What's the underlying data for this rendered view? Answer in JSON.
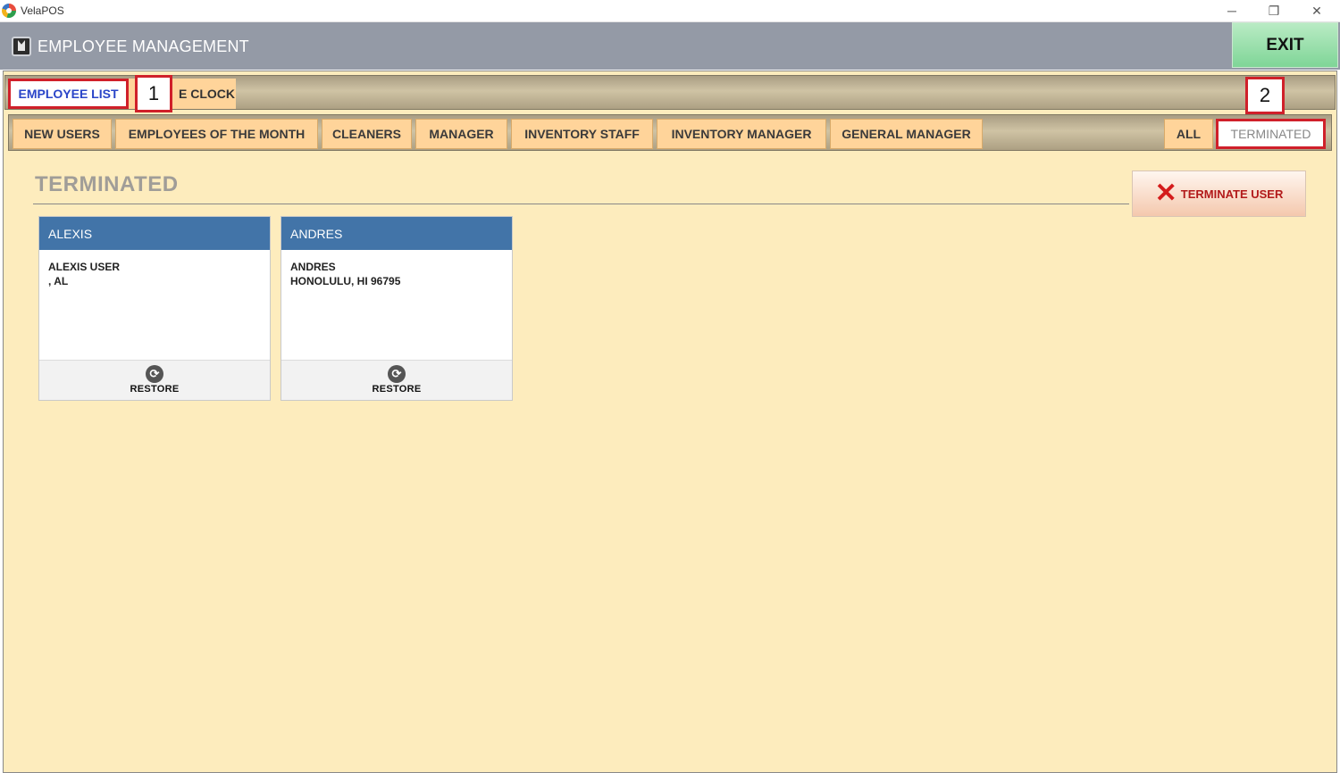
{
  "window": {
    "title": "VelaPOS",
    "controls": {
      "minimize": "─",
      "maximize": "❐",
      "close": "✕"
    }
  },
  "header": {
    "title": "EMPLOYEE MANAGEMENT",
    "exit_label": "EXIT"
  },
  "main_tabs": {
    "employee_list": "EMPLOYEE LIST",
    "time_clock": "E CLOCK"
  },
  "filters": [
    "NEW USERS",
    "EMPLOYEES OF THE MONTH",
    "CLEANERS",
    "MANAGER",
    "INVENTORY STAFF",
    "INVENTORY MANAGER",
    "GENERAL MANAGER",
    "ALL",
    "TERMINATED"
  ],
  "callouts": [
    "1",
    "2"
  ],
  "content": {
    "section_title": "TERMINATED",
    "terminate_label": "TERMINATE USER"
  },
  "employees": [
    {
      "name": "ALEXIS",
      "line1": "ALEXIS USER",
      "line2": ", AL",
      "action": "RESTORE"
    },
    {
      "name": "ANDRES",
      "line1": "ANDRES",
      "line2": "HONOLULU, HI 96795",
      "action": "RESTORE"
    }
  ],
  "colors": {
    "header": "#949aa6",
    "accent_red": "#d0202a",
    "card_header": "#4274a8",
    "tab": "#ffd49a",
    "content_bg": "#fdecbd"
  }
}
